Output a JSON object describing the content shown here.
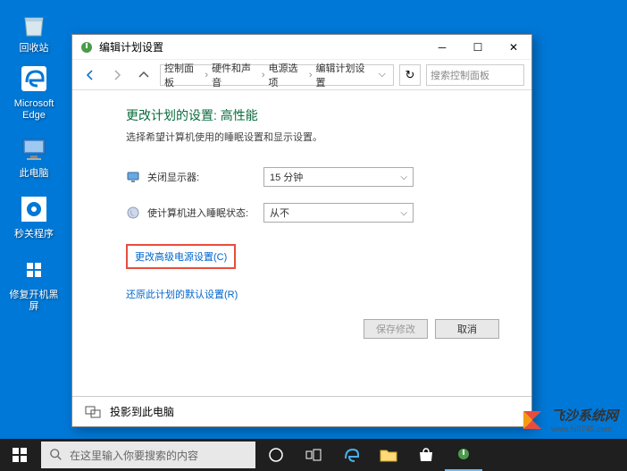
{
  "desktop": {
    "icons": {
      "recycle": "回收站",
      "edge": "Microsoft Edge",
      "pc": "此电脑",
      "app1": "秒关程序",
      "app2": "修复开机黑屏"
    }
  },
  "window": {
    "title": "编辑计划设置",
    "breadcrumb": {
      "items": [
        "控制面板",
        "硬件和声音",
        "电源选项",
        "编辑计划设置"
      ]
    },
    "search_placeholder": "搜索控制面板",
    "page_title": "更改计划的设置: 高性能",
    "page_subtitle": "选择希望计算机使用的睡眠设置和显示设置。",
    "settings": {
      "display_off_label": "关闭显示器:",
      "display_off_value": "15 分钟",
      "sleep_label": "使计算机进入睡眠状态:",
      "sleep_value": "从不"
    },
    "links": {
      "advanced": "更改高级电源设置(C)",
      "restore": "还原此计划的默认设置(R)"
    },
    "buttons": {
      "save": "保存修改",
      "cancel": "取消"
    },
    "bottom_panel": "投影到此电脑"
  },
  "taskbar": {
    "search_placeholder": "在这里输入你要搜索的内容"
  },
  "watermark": {
    "brand": "飞沙系统网",
    "url": "www.fs0745.com"
  }
}
